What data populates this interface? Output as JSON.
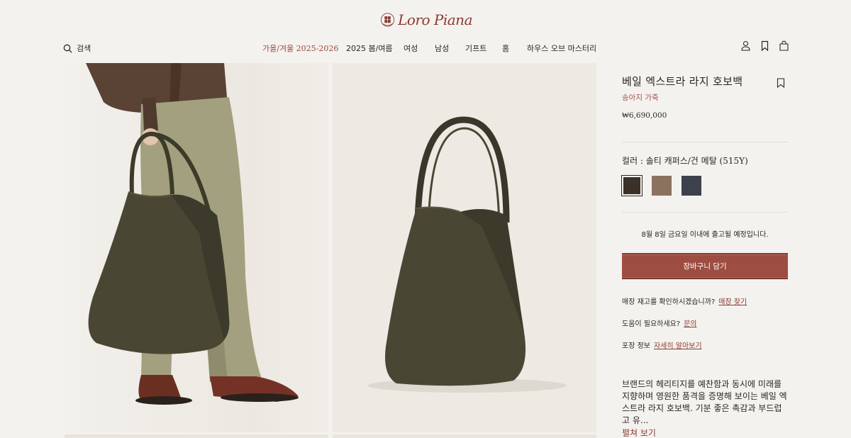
{
  "brand": {
    "logo_text": "Loro Piana"
  },
  "header": {
    "search_label": "검색",
    "nav": [
      {
        "label": "가을/겨울 2025-2026",
        "active": true
      },
      {
        "label": "2025 봄/여름",
        "active": false
      },
      {
        "label": "여성",
        "active": false
      },
      {
        "label": "남성",
        "active": false
      },
      {
        "label": "기프트",
        "active": false
      },
      {
        "label": "홈",
        "active": false
      },
      {
        "label": "하우스 오브 마스터리",
        "active": false
      }
    ],
    "icons": [
      "user-icon",
      "bookmark-icon",
      "shopping-bag-icon"
    ]
  },
  "gallery": {
    "images": [
      "model-holding-bag-image",
      "bag-product-image"
    ]
  },
  "product": {
    "title": "베일 엑스트라 라지 호보백",
    "material": "송아지 가죽",
    "price": "₩6,690,000",
    "color_label": "컬러 : 솔티 캐퍼스/건 메탈 (515Y)",
    "swatches": [
      {
        "color": "#3a3128",
        "selected": true
      },
      {
        "color": "#8b7260",
        "selected": false
      },
      {
        "color": "#3c414c",
        "selected": false
      }
    ],
    "shipping_note": "8월 8일 금요일 이내에 출고될 예정입니다.",
    "add_to_cart": "장바구니 담기",
    "store_question": "매장 재고를 확인하시겠습니까?",
    "store_link": "매장 찾기",
    "help_question": "도움이 필요하세요?",
    "help_link": "문의",
    "packaging_label": "포장 정보",
    "packaging_link": "자세히 알아보기",
    "description": "브랜드의 헤리티지를 예찬함과 동시에 미래를 지향하며 영원한 품격을 증명해 보이는 베일 엑스트라 라지 호보백. 기분 좋은 촉감과 부드럽고 유...",
    "more_label": "펼쳐 보기"
  },
  "colors": {
    "accent": "#9e4d42",
    "link": "#8a3a33",
    "bag": "#4a4634"
  }
}
